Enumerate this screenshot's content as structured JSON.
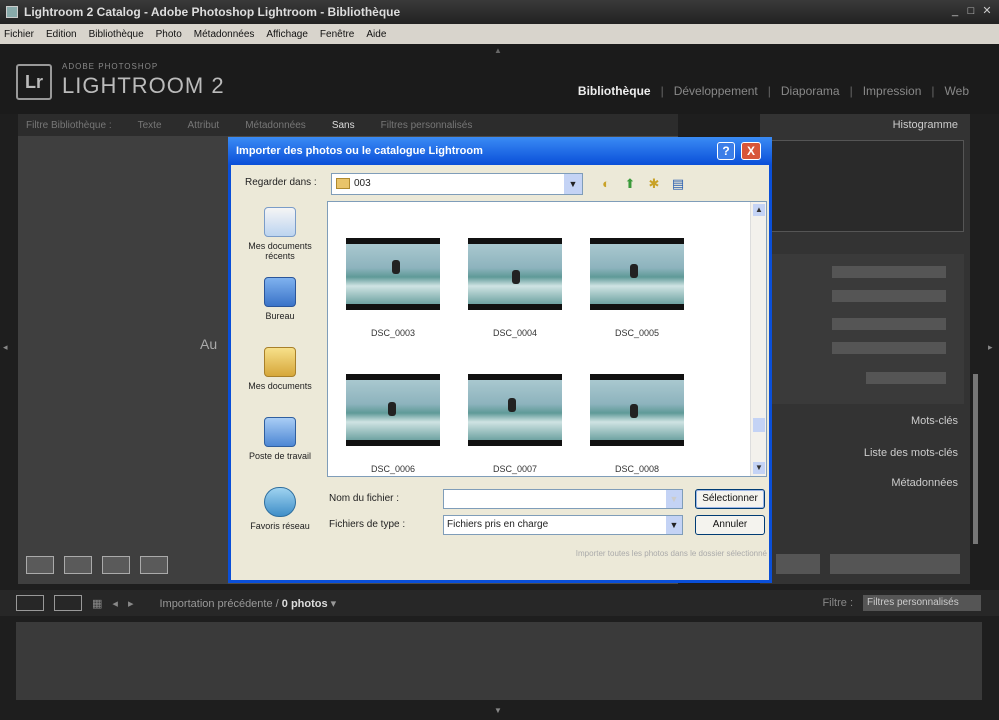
{
  "window": {
    "title": "Lightroom 2 Catalog - Adobe Photoshop Lightroom - Bibliothèque"
  },
  "menu": [
    "Fichier",
    "Edition",
    "Bibliothèque",
    "Photo",
    "Métadonnées",
    "Affichage",
    "Fenêtre",
    "Aide"
  ],
  "brand": {
    "small": "ADOBE PHOTOSHOP",
    "big": "LIGHTROOM 2",
    "logo": "Lr"
  },
  "modules": [
    {
      "label": "Bibliothèque"
    },
    {
      "label": "Développement"
    },
    {
      "label": "Diaporama"
    },
    {
      "label": "Impression"
    },
    {
      "label": "Web"
    }
  ],
  "toolbar": {
    "items": [
      "Filtre Bibliothèque :",
      "Texte",
      "Attribut",
      "Métadonnées",
      "Sans",
      "Filtres personnalisés"
    ]
  },
  "center": {
    "partial_text": "Au"
  },
  "right_panel": {
    "histogram": "Histogramme",
    "keywords": "Mots-clés",
    "keyword_list": "Liste des mots-clés",
    "metadata": "Métadonnées"
  },
  "filmstrip": {
    "path_prefix": "Importation précédente /",
    "photos": "0 photos",
    "filter_label": "Filtre :",
    "filter_value": "Filtres personnalisés"
  },
  "dialog": {
    "title": "Importer des photos ou le catalogue Lightroom",
    "help": "?",
    "close": "X",
    "look_in_label": "Regarder dans :",
    "look_in_value": "003",
    "places": [
      "Mes documents récents",
      "Bureau",
      "Mes documents",
      "Poste de travail",
      "Favoris réseau"
    ],
    "files": [
      "DSC_0003",
      "DSC_0004",
      "DSC_0005",
      "DSC_0006",
      "DSC_0007",
      "DSC_0008"
    ],
    "filename_label": "Nom du fichier :",
    "filename_value": "",
    "filetype_label": "Fichiers de type :",
    "filetype_value": "Fichiers pris en charge",
    "select_button": "Sélectionner",
    "cancel_button": "Annuler",
    "hint": "Importer toutes les photos dans le dossier sélectionné"
  }
}
